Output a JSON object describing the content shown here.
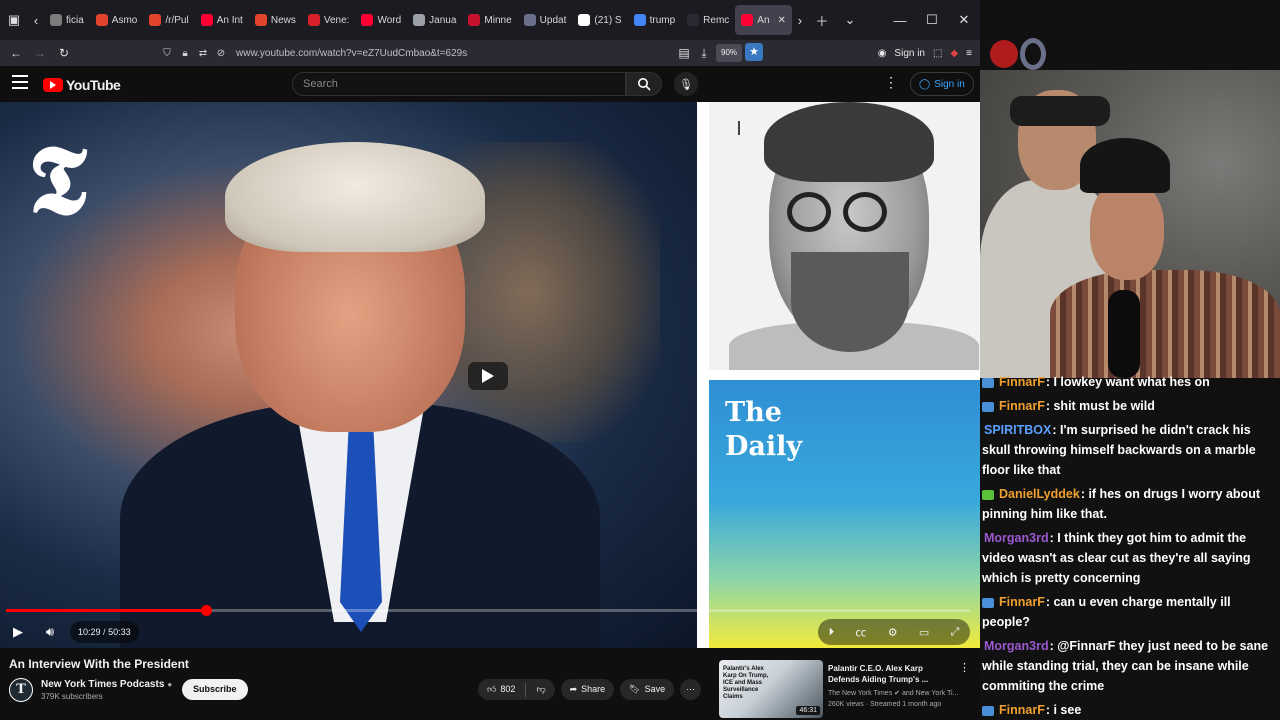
{
  "browser": {
    "tabs": [
      {
        "label": "ficia",
        "color": "#7c7c7c"
      },
      {
        "label": "Asmo",
        "color": "#e0452c"
      },
      {
        "label": "/r/Pul",
        "color": "#e0452c"
      },
      {
        "label": "An Int",
        "color": "#ff0033"
      },
      {
        "label": "News",
        "color": "#e0452c"
      },
      {
        "label": "Vene:",
        "color": "#d8202a"
      },
      {
        "label": "Word",
        "color": "#ff0033"
      },
      {
        "label": "Janua",
        "color": "#9aa0a6"
      },
      {
        "label": "Minne",
        "color": "#c4122f"
      },
      {
        "label": "Updat",
        "color": "#6a6f8a"
      },
      {
        "label": "(21) S",
        "color": "#ffffff"
      },
      {
        "label": "trump",
        "color": "#4285f4"
      },
      {
        "label": "Remc",
        "color": "#2b2a33"
      },
      {
        "label": "An",
        "color": "#ff0033"
      }
    ],
    "url": "www.youtube.com/watch?v=eZ7UudCmbao&t=629s",
    "zoom": "90%",
    "signin": "Sign in"
  },
  "youtube": {
    "logo_text": "YouTube",
    "search_placeholder": "Search",
    "signin_label": "Sign in"
  },
  "player": {
    "thumbnail_right_title_line1": "The",
    "thumbnail_right_title_line2": "Daily",
    "current_time": "10:29",
    "duration": "50:33",
    "progress_fraction": 0.207
  },
  "video": {
    "title": "An Interview With the President",
    "channel": "New York Times Podcasts",
    "channel_initial": "T",
    "subscribers": "379K subscribers",
    "subscribe_label": "Subscribe",
    "likes": "802",
    "share_label": "Share",
    "save_label": "Save"
  },
  "recommendation": {
    "thumb_text": "Palantir's Alex Karp On Trump, ICE and Mass Surveillance Claims",
    "duration": "46:31",
    "title": "Palantir C.E.O. Alex Karp Defends Aiding Trump's ...",
    "channel": "The New York Times ✔ and New York Ti...",
    "meta": "260K views · Streamed 1 month ago"
  },
  "chat": [
    {
      "user": "FinnarF",
      "user_color": "#f0a030",
      "badge": "#4a90d9",
      "text": ": I lowkey want what hes on"
    },
    {
      "user": "FinnarF",
      "user_color": "#f0a030",
      "badge": "#4a90d9",
      "text": ": shit must be wild"
    },
    {
      "user": "SPIRITBOX",
      "user_color": "#5aa0ff",
      "badge": "",
      "text": ": I'm surprised he didn't crack his skull throwing himself backwards on a marble floor like that"
    },
    {
      "user": "DanielLyddek",
      "user_color": "#f0a030",
      "badge": "#5bbf3a",
      "text": ": if hes on drugs I worry about pinning him like that."
    },
    {
      "user": "Morgan3rd",
      "user_color": "#9b59d0",
      "badge": "",
      "text": ": I think they got him to admit the video wasn't as clear cut as they're all saying which is pretty concerning"
    },
    {
      "user": "FinnarF",
      "user_color": "#f0a030",
      "badge": "#4a90d9",
      "text": ": can u even charge mentally ill people?"
    },
    {
      "user": "Morgan3rd",
      "user_color": "#9b59d0",
      "badge": "",
      "text": ": @FinnarF they just need to be sane while standing trial, they can be insane while commiting the crime"
    },
    {
      "user": "FinnarF",
      "user_color": "#f0a030",
      "badge": "#4a90d9",
      "text": ": i see"
    }
  ]
}
